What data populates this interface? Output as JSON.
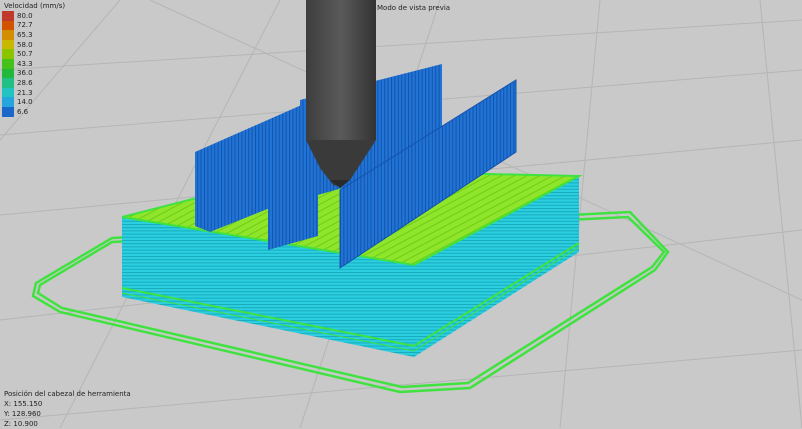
{
  "legend": {
    "title": "Velocidad (mm/s)",
    "items": [
      {
        "value": "80.0",
        "color": "#c0392b"
      },
      {
        "value": "72.7",
        "color": "#d35400"
      },
      {
        "value": "65.3",
        "color": "#d58d00"
      },
      {
        "value": "58.0",
        "color": "#c9b800"
      },
      {
        "value": "50.7",
        "color": "#8cc400"
      },
      {
        "value": "43.3",
        "color": "#45c11a"
      },
      {
        "value": "36.0",
        "color": "#21b83b"
      },
      {
        "value": "28.6",
        "color": "#1fbf86"
      },
      {
        "value": "21.3",
        "color": "#21c3c3"
      },
      {
        "value": "14.0",
        "color": "#26a4dc"
      },
      {
        "value": "6.6",
        "color": "#1a67c9"
      }
    ]
  },
  "view_mode": "Modo de vista previa",
  "coordinates": {
    "title": "Posición del cabezal de herramienta",
    "x": "X: 155.150",
    "y": "Y: 128.960",
    "z": "Z: 10.900"
  },
  "colors": {
    "background": "#c9c9c9",
    "grid": "#b4b4b4",
    "skirt": "#3fe23f",
    "walls": "#2ad0e0",
    "infill": "#8fe52a",
    "ribs": "#1d6fd1",
    "nozzle": "#4a4a4a"
  }
}
